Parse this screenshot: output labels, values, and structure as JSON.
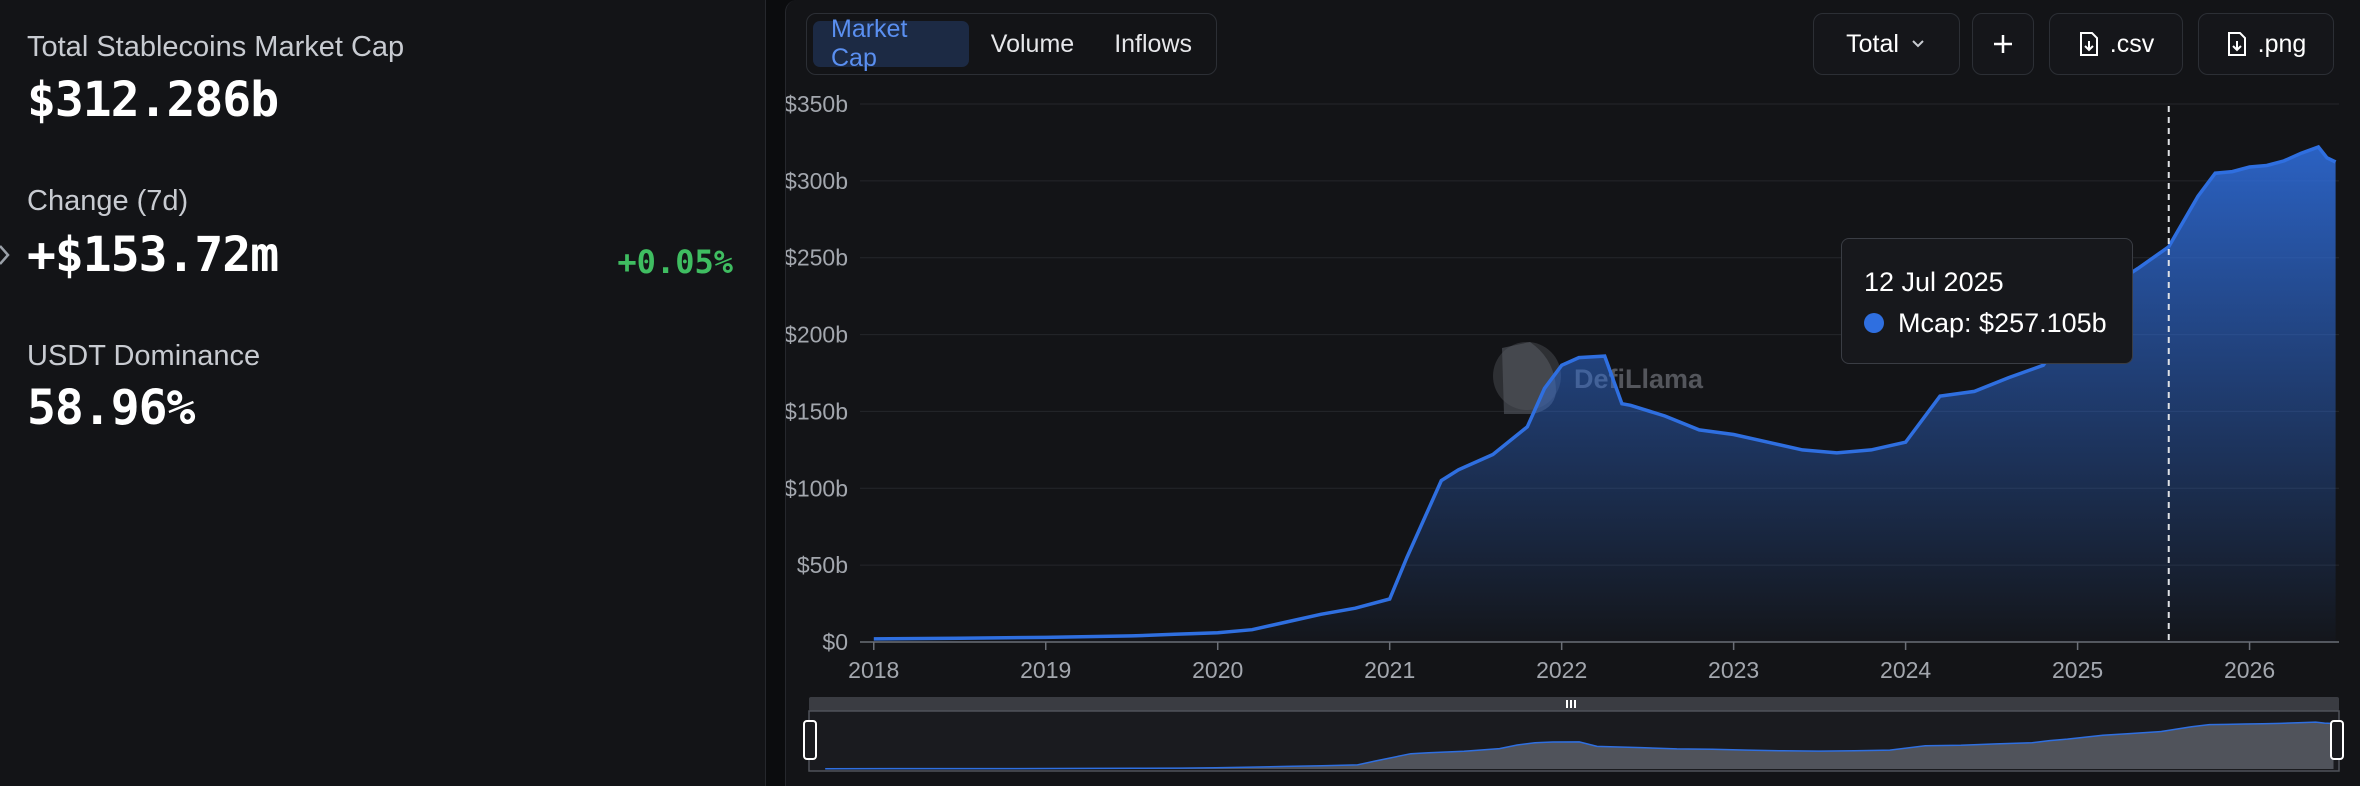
{
  "stats": {
    "total_label": "Total Stablecoins Market Cap",
    "total_value": "$312.286b",
    "change_label": "Change (7d)",
    "change_value": "+$153.72m",
    "change_pct": "+0.05%",
    "dominance_label": "USDT Dominance",
    "dominance_value": "58.96%"
  },
  "tabs": [
    {
      "label": "Market Cap",
      "active": true
    },
    {
      "label": "Volume",
      "active": false
    },
    {
      "label": "Inflows",
      "active": false
    }
  ],
  "toolbar": {
    "total_select": "Total",
    "add_label": "+",
    "csv_label": ".csv",
    "png_label": ".png"
  },
  "watermark": "DefiLlama",
  "tooltip": {
    "date": "12 Jul 2025",
    "series_label": "Mcap:",
    "value": "$257.105b"
  },
  "colors": {
    "accent": "#2f6fe0",
    "positive": "#3fbd61",
    "background": "#131417"
  },
  "chart_data": {
    "type": "area",
    "title": "",
    "xlabel": "",
    "ylabel": "",
    "series": [
      {
        "name": "Mcap",
        "x": [
          2018.0,
          2018.5,
          2019.0,
          2019.5,
          2019.75,
          2020.0,
          2020.2,
          2020.4,
          2020.6,
          2020.8,
          2021.0,
          2021.1,
          2021.3,
          2021.4,
          2021.6,
          2021.8,
          2021.9,
          2022.0,
          2022.1,
          2022.25,
          2022.35,
          2022.4,
          2022.6,
          2022.8,
          2023.0,
          2023.2,
          2023.4,
          2023.6,
          2023.8,
          2024.0,
          2024.2,
          2024.4,
          2024.6,
          2024.8,
          2024.9,
          2025.0,
          2025.2,
          2025.35,
          2025.53,
          2025.7,
          2025.8,
          2025.9,
          2026.0,
          2026.1,
          2026.2,
          2026.3,
          2026.4,
          2026.45,
          2026.5
        ],
        "values": [
          2,
          2.5,
          3,
          4,
          5,
          6,
          8,
          13,
          18,
          22,
          28,
          55,
          105,
          112,
          122,
          140,
          165,
          180,
          185,
          186,
          155,
          154,
          147,
          138,
          135,
          130,
          125,
          123,
          125,
          130,
          160,
          163,
          172,
          180,
          195,
          205,
          232,
          243,
          257.105,
          290,
          305,
          306,
          309,
          310,
          313,
          318,
          322,
          315,
          312.286
        ]
      }
    ],
    "x_ticks": [
      "2018",
      "2019",
      "2020",
      "2021",
      "2022",
      "2023",
      "2024",
      "2025",
      "2026"
    ],
    "y_ticks": [
      "$0",
      "$50b",
      "$100b",
      "$150b",
      "$200b",
      "$250b",
      "$300b",
      "$350b"
    ],
    "ylim": [
      0,
      350
    ],
    "xlim": [
      2017.92,
      2026.52
    ],
    "grid": true,
    "crosshair_x": 2025.53
  }
}
